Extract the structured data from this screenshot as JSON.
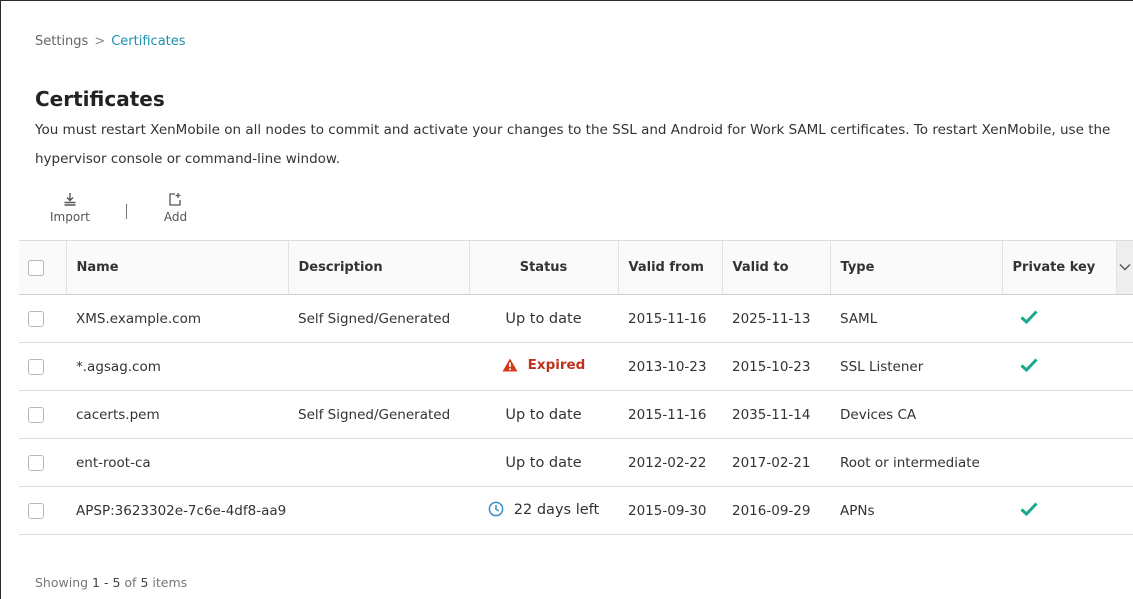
{
  "breadcrumb": {
    "parent": "Settings",
    "separator": ">",
    "current": "Certificates"
  },
  "page": {
    "title": "Certificates",
    "intro_line1": "You must restart XenMobile on all nodes to commit and activate your changes to the SSL and Android for Work SAML certificates. To restart XenMobile, use the",
    "intro_line2": "hypervisor console or command-line window."
  },
  "toolbar": {
    "import": {
      "label": "Import",
      "icon": "import-icon"
    },
    "add": {
      "label": "Add",
      "icon": "add-icon"
    }
  },
  "table": {
    "columns": [
      "Name",
      "Description",
      "Status",
      "Valid from",
      "Valid to",
      "Type",
      "Private key"
    ],
    "rows": [
      {
        "name": "XMS.example.com",
        "description": "Self Signed/Generated",
        "status": "Up to date",
        "status_kind": "ok",
        "valid_from": "2015-11-16",
        "valid_to": "2025-11-13",
        "type": "SAML",
        "private_key": true
      },
      {
        "name": "*.agsag.com",
        "description": "",
        "status": "Expired",
        "status_kind": "expired",
        "valid_from": "2013-10-23",
        "valid_to": "2015-10-23",
        "type": "SSL Listener",
        "private_key": true
      },
      {
        "name": "cacerts.pem",
        "description": "Self Signed/Generated",
        "status": "Up to date",
        "status_kind": "ok",
        "valid_from": "2015-11-16",
        "valid_to": "2035-11-14",
        "type": "Devices CA",
        "private_key": false
      },
      {
        "name": "ent-root-ca",
        "description": "",
        "status": "Up to date",
        "status_kind": "ok",
        "valid_from": "2012-02-22",
        "valid_to": "2017-02-21",
        "type": "Root or intermediate",
        "private_key": false
      },
      {
        "name": "APSP:3623302e-7c6e-4df8-aa9",
        "description": "",
        "status": "22 days left",
        "status_kind": "warning",
        "valid_from": "2015-09-30",
        "valid_to": "2016-09-29",
        "type": "APNs",
        "private_key": true
      }
    ]
  },
  "footer": {
    "prefix": "Showing",
    "range": "1 - 5",
    "of": "of",
    "total": "5",
    "suffix": "items"
  },
  "colors": {
    "accent": "#1f8fb0",
    "check": "#1aa88a",
    "error": "#d63a1e",
    "clock": "#3a8fc4"
  }
}
